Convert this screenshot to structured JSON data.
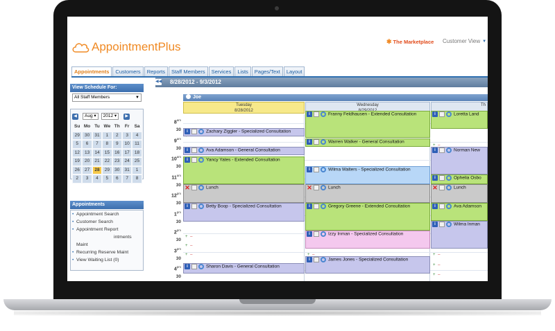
{
  "app": {
    "logo_text": "AppointmentPlus",
    "marketplace": "The Marketplace",
    "customer_view": "Customer View"
  },
  "tabs": [
    "Appointments",
    "Customers",
    "Reports",
    "Staff Members",
    "Services",
    "Lists",
    "Pages/Text",
    "Layout"
  ],
  "sidebar": {
    "schedule_title": "View Schedule For:",
    "staff_select": "All Staff Members",
    "month": "Aug",
    "year": "2012",
    "weekdays": [
      "Su",
      "Mo",
      "Tu",
      "We",
      "Th",
      "Fr",
      "Sa"
    ],
    "weeks": [
      [
        "29",
        "30",
        "31",
        "1",
        "2",
        "3",
        "4"
      ],
      [
        "5",
        "6",
        "7",
        "8",
        "9",
        "10",
        "11"
      ],
      [
        "12",
        "13",
        "14",
        "15",
        "16",
        "17",
        "18"
      ],
      [
        "19",
        "20",
        "21",
        "22",
        "23",
        "24",
        "25"
      ],
      [
        "26",
        "27",
        "28",
        "29",
        "30",
        "31",
        "1"
      ],
      [
        "2",
        "3",
        "4",
        "5",
        "6",
        "7",
        "8"
      ]
    ],
    "today": "28",
    "appointments_title": "Appointments",
    "links": [
      "Appointment Search",
      "Customer Search",
      "Appointment Report",
      "intments",
      "Maint",
      "Recurring Reserve Maint",
      "View Waiting List (0)"
    ]
  },
  "toolbar": {
    "date_range": "8/28/2012 - 9/3/2012"
  },
  "schedule": {
    "staff_name": "Joe",
    "days": [
      {
        "name": "Tuesday",
        "date": "8/28/2012"
      },
      {
        "name": "Wednesday",
        "date": "8/29/2012"
      },
      {
        "name": "Th",
        "date": ""
      }
    ],
    "times": [
      {
        "hour": "8",
        "ampm": "am"
      },
      {
        "hour": "9",
        "ampm": "am"
      },
      {
        "hour": "10",
        "ampm": "am"
      },
      {
        "hour": "11",
        "ampm": "am"
      },
      {
        "hour": "12",
        "ampm": "pm"
      },
      {
        "hour": "1",
        "ampm": "pm"
      },
      {
        "hour": "2",
        "ampm": "pm"
      },
      {
        "hour": "3",
        "ampm": "pm"
      },
      {
        "hour": "4",
        "ampm": "pm"
      }
    ],
    "half": "30",
    "tuesday": [
      "Zachary Ziggler - Specialized Consultation",
      "Ava Adamson - General Consultation",
      "Yancy Yates - Extended Consultation",
      "Lunch",
      "Betty Boop - Specialized Consultation",
      "Sharon Davis - General Consultation"
    ],
    "wednesday": [
      "Franny Feldhausen - Extended Consultation",
      "Warren Walker - General Consultation",
      "Wilma Walters - Specialized Consultation",
      "Lunch",
      "Gregory Greene - Extended Consultation",
      "Izzy Inman - Specialized Consultation",
      "James Jones - Specialized Consultation"
    ],
    "thursday": [
      "Loretta Land",
      "Norman New",
      "Ophelia Osbo",
      "Lunch",
      "Ava Adamson",
      "Wilma Inman"
    ]
  }
}
